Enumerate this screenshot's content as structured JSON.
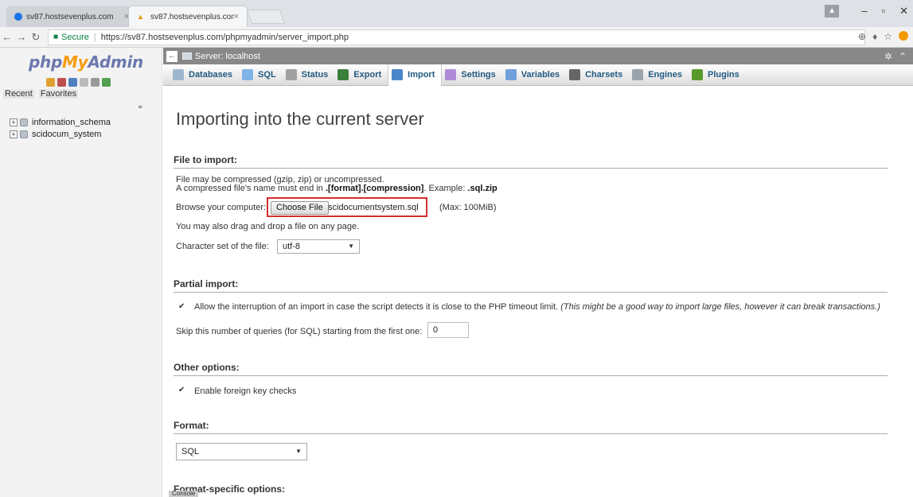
{
  "browser": {
    "tabs": [
      {
        "label": "sv87.hostsevenplus.com",
        "close": "×"
      },
      {
        "label": "sv87.hostsevenplus.com",
        "close": "×"
      }
    ],
    "secure_label": "Secure",
    "url": "https://sv87.hostsevenplus.com/phpmyadmin/server_import.php"
  },
  "sidebar": {
    "logo_php": "php",
    "logo_my": "My",
    "logo_admin": "Admin",
    "tabs": [
      "Recent",
      "Favorites"
    ],
    "databases": [
      "information_schema",
      "scidocum_system"
    ]
  },
  "header": {
    "server_label": "Server: localhost"
  },
  "menu": {
    "items": [
      {
        "label": "Databases",
        "icon": "database-icon",
        "color": "#9fb7cf"
      },
      {
        "label": "SQL",
        "icon": "sql-icon",
        "color": "#7fb3e6"
      },
      {
        "label": "Status",
        "icon": "status-icon",
        "color": "#a0a0a0"
      },
      {
        "label": "Export",
        "icon": "export-icon",
        "color": "#3a7f3a"
      },
      {
        "label": "Import",
        "icon": "import-icon",
        "color": "#4a86c7"
      },
      {
        "label": "Settings",
        "icon": "settings-icon",
        "color": "#b08bd8"
      },
      {
        "label": "Variables",
        "icon": "variables-icon",
        "color": "#6fa0d9"
      },
      {
        "label": "Charsets",
        "icon": "charsets-icon",
        "color": "#666666"
      },
      {
        "label": "Engines",
        "icon": "engines-icon",
        "color": "#9aa4ae"
      },
      {
        "label": "Plugins",
        "icon": "plugins-icon",
        "color": "#5a9a2a"
      }
    ],
    "active": "Import"
  },
  "main": {
    "title": "Importing into the current server",
    "file_to_import": {
      "heading": "File to import:",
      "line1": "File may be compressed (gzip, zip) or uncompressed.",
      "line2_pre": "A compressed file's name must end in ",
      "line2_bold": ".[format].[compression]",
      "line2_mid": ". Example: ",
      "line2_example": ".sql.zip",
      "browse_label": "Browse your computer:",
      "choose_button": "Choose File",
      "file_name": "scidocumentsystem.sql",
      "max_size": "(Max: 100MiB)",
      "drag_hint": "You may also drag and drop a file on any page.",
      "charset_label": "Character set of the file:",
      "charset_value": "utf-8"
    },
    "partial_import": {
      "heading": "Partial import:",
      "allow_label": "Allow the interruption of an import in case the script detects it is close to the PHP timeout limit.",
      "allow_note": "(This might be a good way to import large files, however it can break transactions.)",
      "allow_checked": true,
      "skip_label": "Skip this number of queries (for SQL) starting from the first one:",
      "skip_value": "0"
    },
    "other_options": {
      "heading": "Other options:",
      "fk_label": "Enable foreign key checks",
      "fk_checked": true
    },
    "format": {
      "heading": "Format:",
      "value": "SQL"
    },
    "format_specific": {
      "heading": "Format-specific options:"
    }
  },
  "console_label": "Console"
}
